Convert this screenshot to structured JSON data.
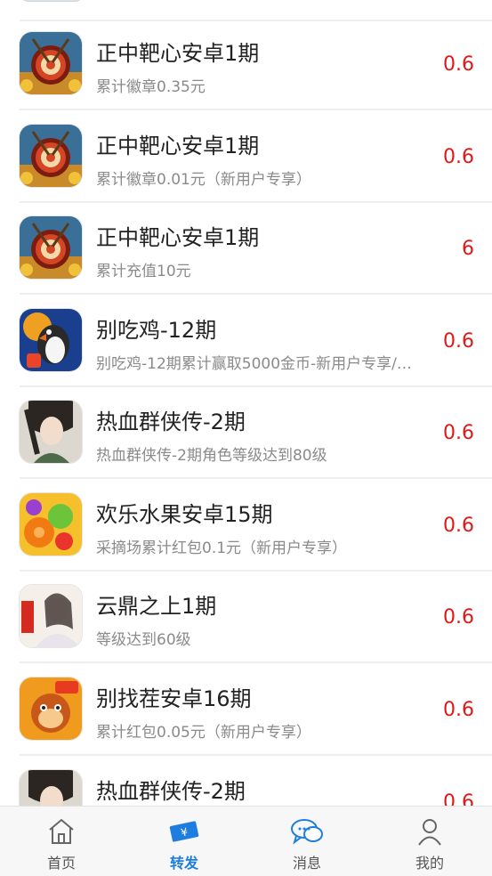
{
  "items": [
    {
      "title": "正中靶心安卓1期",
      "desc": "累计徽章0.35元",
      "price": "0.6",
      "icon": "target-game-icon"
    },
    {
      "title": "正中靶心安卓1期",
      "desc": "累计徽章0.01元（新用户专享）",
      "price": "0.6",
      "icon": "target-game-icon"
    },
    {
      "title": "正中靶心安卓1期",
      "desc": "累计充值10元",
      "price": "6",
      "icon": "target-game-icon"
    },
    {
      "title": "别吃鸡-12期",
      "desc": "别吃鸡-12期累计赢取5000金币-新用户专享/…",
      "price": "0.6",
      "icon": "chicken-game-icon"
    },
    {
      "title": "热血群侠传-2期",
      "desc": "热血群侠传-2期角色等级达到80级",
      "price": "0.6",
      "icon": "hero-game-icon"
    },
    {
      "title": "欢乐水果安卓15期",
      "desc": "采摘场累计红包0.1元（新用户专享）",
      "price": "0.6",
      "icon": "fruit-game-icon"
    },
    {
      "title": "云鼎之上1期",
      "desc": "等级达到60级",
      "price": "0.6",
      "icon": "fairy-game-icon"
    },
    {
      "title": "别找茬安卓16期",
      "desc": "累计红包0.05元（新用户专享）",
      "price": "0.6",
      "icon": "monkey-game-icon"
    },
    {
      "title": "热血群侠传-2期",
      "desc": "",
      "price": "0.6",
      "icon": "hero-game-icon"
    }
  ],
  "tabbar": {
    "tabs": [
      {
        "label": "首页",
        "icon": "home-icon",
        "active": false
      },
      {
        "label": "转发",
        "icon": "ticket-icon",
        "active": true
      },
      {
        "label": "消息",
        "icon": "chat-icon",
        "active": false
      },
      {
        "label": "我的",
        "icon": "user-icon",
        "active": false
      }
    ]
  },
  "colors": {
    "price": "#e01818",
    "accent": "#1e7ee0",
    "title": "#222222",
    "desc": "#8a8a8a"
  }
}
